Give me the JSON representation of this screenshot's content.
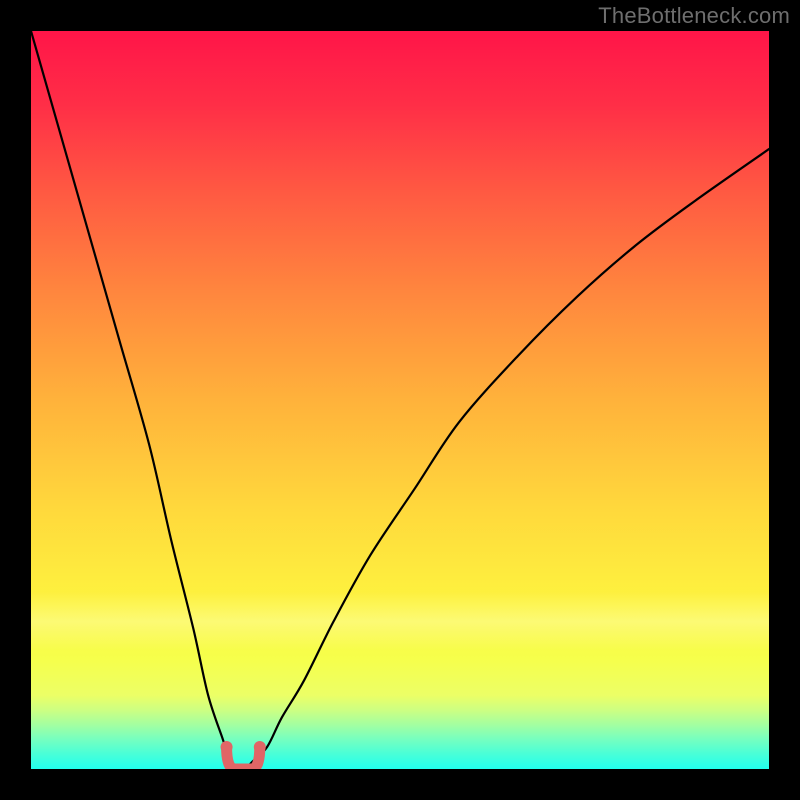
{
  "watermark": "TheBottleneck.com",
  "chart_data": {
    "type": "line",
    "title": "",
    "xlabel": "",
    "ylabel": "",
    "xlim": [
      0,
      100
    ],
    "ylim": [
      0,
      100
    ],
    "series": [
      {
        "name": "bottleneck-curve",
        "x": [
          0,
          4,
          8,
          12,
          16,
          19,
          22,
          24,
          26,
          27,
          28,
          29,
          30,
          32,
          34,
          37,
          41,
          46,
          52,
          58,
          66,
          74,
          82,
          90,
          100
        ],
        "y": [
          100,
          86,
          72,
          58,
          44,
          31,
          19,
          10,
          4,
          1,
          0,
          0,
          1,
          3,
          7,
          12,
          20,
          29,
          38,
          47,
          56,
          64,
          71,
          77,
          84
        ]
      }
    ],
    "sweet_spot": {
      "x_start": 26.5,
      "x_end": 31,
      "y": 0
    },
    "gradient_stops": [
      {
        "pct": 0,
        "color": "#ff1548"
      },
      {
        "pct": 50,
        "color": "#ffb23b"
      },
      {
        "pct": 78,
        "color": "#fdf43f"
      },
      {
        "pct": 100,
        "color": "#22ffee"
      }
    ]
  }
}
